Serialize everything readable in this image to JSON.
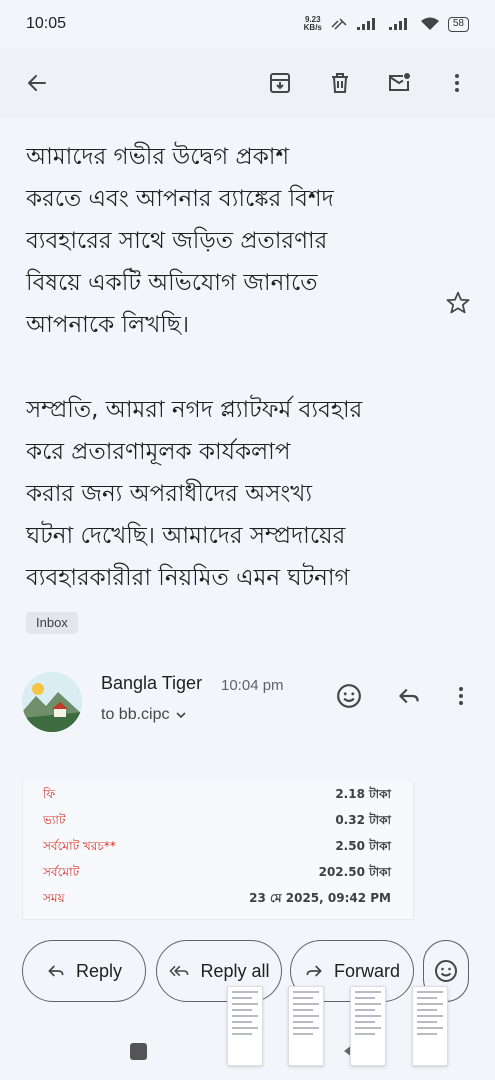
{
  "status_bar": {
    "time": "10:05",
    "speed_value": "9.23",
    "speed_unit": "KB/s",
    "battery": "58"
  },
  "email": {
    "body_line_partial": "আমাদের গভীর উদ্বেগ প্রকাশ",
    "paragraph1": [
      "আমাদের গভীর উদ্বেগ প্রকাশ",
      "করতে এবং আপনার ব্যাঙ্কের বিশদ",
      "ব্যবহারের সাথে জড়িত প্রতারণার",
      "বিষয়ে একটি অভিযোগ জানাতে",
      "আপনাকে লিখছি।"
    ],
    "paragraph2": [
      "সম্প্রতি, আমরা নগদ প্ল্যাটফর্ম ব্যবহার",
      "করে প্রতারণামূলক কার্যকলাপ",
      "করার জন্য অপরাধীদের অসংখ্য",
      "ঘটনা দেখেছি। আমাদের সম্প্রদায়ের",
      "ব্যবহারকারীরা নিয়মিত এমন ঘটনাগ"
    ],
    "label_chip": "Inbox"
  },
  "message": {
    "sender_name": "Bangla Tiger",
    "time": "10:04 pm",
    "recipient": "to bb.cipc"
  },
  "receipt": {
    "rows": [
      {
        "label": "ফি",
        "value": "2.18 টাকা"
      },
      {
        "label": "ভ্যাট",
        "value": "0.32 টাকা"
      },
      {
        "label": "সর্বমোট খরচ**",
        "value": "2.50 টাকা"
      },
      {
        "label": "সর্বমোট",
        "value": "202.50 টাকা"
      },
      {
        "label": "সময়",
        "value": "23 মে 2025, 09:42 PM"
      }
    ]
  },
  "actions": {
    "reply": "Reply",
    "reply_all": "Reply all",
    "forward": "Forward"
  },
  "colors": {
    "background": "#f2f6fb",
    "receipt_label": "#d93025"
  }
}
